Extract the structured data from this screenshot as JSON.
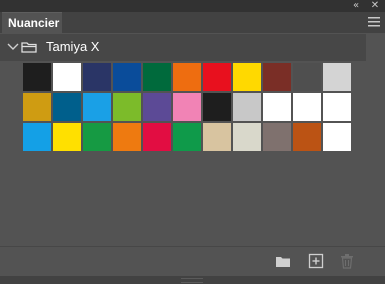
{
  "panel": {
    "tab_label": "Nuancier",
    "collapse_glyph": "«",
    "close_glyph": "✕"
  },
  "group": {
    "name": "Tamiya X",
    "expanded": true
  },
  "swatches": [
    "#1e1e1e",
    "#ffffff",
    "#2a3566",
    "#0a4c9a",
    "#006a3c",
    "#ee6d10",
    "#e8101e",
    "#ffd900",
    "#7a2e26",
    "#4f4f4f",
    "#d4d4d4",
    "#cf9c12",
    "#005f8c",
    "#1aa0e6",
    "#7cbb2a",
    "#5c4a96",
    "#f183b5",
    "#1e1e1e",
    "#c8c8c8",
    "#ffffff",
    "#ffffff",
    "#ffffff",
    "#14a0e6",
    "#ffe000",
    "#169a43",
    "#ee7a10",
    "#e20d42",
    "#0f9a4a",
    "#d8c4a0",
    "#d9d8cb",
    "#7f716e",
    "#bb5314",
    "#ffffff"
  ],
  "bottom_icons": [
    "new-group-folder-icon",
    "new-swatch-icon",
    "delete-icon"
  ],
  "colors": {
    "panel_bg": "#535353",
    "tab_strip": "#424242",
    "top_bar": "#323232",
    "group_row": "#474747",
    "text": "#ffffff"
  }
}
